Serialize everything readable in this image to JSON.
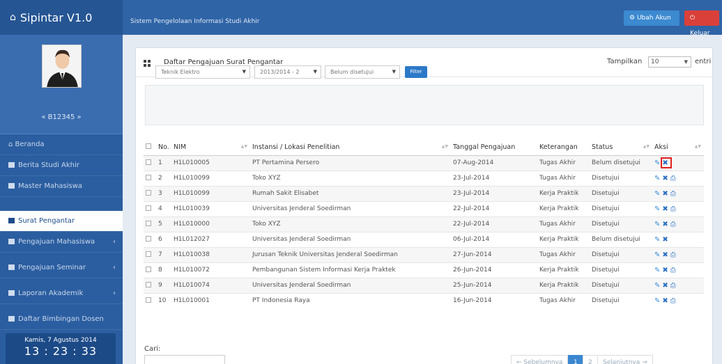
{
  "app": {
    "title": "Sipintar V1.0",
    "system_name": "Sistem Pengelolaan Informasi Studi Akhir"
  },
  "topbar": {
    "account_label": "Ubah Akun",
    "logout_label": "Keluar"
  },
  "user": {
    "id": "« B12345 »"
  },
  "sidebar": {
    "items": [
      {
        "label": "Beranda"
      },
      {
        "label": "Berita Studi Akhir"
      },
      {
        "label": "Master Mahasiswa"
      },
      {
        "label": "Surat Pengantar"
      },
      {
        "label": "Pengajuan Mahasiswa"
      },
      {
        "label": "Pengajuan Seminar"
      },
      {
        "label": "Laporan Akademik"
      },
      {
        "label": "Daftar Bimbingan Dosen"
      }
    ],
    "date": "Kamis, 7 Agustus 2014",
    "time": "13 : 23 : 33"
  },
  "panel": {
    "title": "Daftar Pengajuan Surat Pengantar",
    "show_label": "Tampilkan",
    "show_value": "10",
    "entries_label": "entri"
  },
  "filters": {
    "jurusan": "Teknik Elektro",
    "periode": "2013/2014 - 2",
    "status": "Belum disetujui",
    "button": "Filter"
  },
  "table": {
    "headers": [
      "No.",
      "NIM",
      "Instansi / Lokasi Penelitian",
      "Tanggal Pengajuan",
      "Keterangan",
      "Status",
      "Aksi"
    ],
    "rows": [
      {
        "no": "1",
        "nim": "H1L010005",
        "instansi": "PT Pertamina Persero",
        "tanggal": "07-Aug-2014",
        "ket": "Tugas Akhir",
        "status": "Belum disetujui"
      },
      {
        "no": "2",
        "nim": "H1L010099",
        "instansi": "Toko XYZ",
        "tanggal": "23-Jul-2014",
        "ket": "Tugas Akhir",
        "status": "Disetujui"
      },
      {
        "no": "3",
        "nim": "H1L010099",
        "instansi": "Rumah Sakit Elisabet",
        "tanggal": "23-Jul-2014",
        "ket": "Kerja Praktik",
        "status": "Disetujui"
      },
      {
        "no": "4",
        "nim": "H1L010039",
        "instansi": "Universitas Jenderal Soedirman",
        "tanggal": "22-Jul-2014",
        "ket": "Kerja Praktik",
        "status": "Disetujui"
      },
      {
        "no": "5",
        "nim": "H1L010000",
        "instansi": "Toko XYZ",
        "tanggal": "22-Jul-2014",
        "ket": "Tugas Akhir",
        "status": "Disetujui"
      },
      {
        "no": "6",
        "nim": "H1L012027",
        "instansi": "Universitas Jenderal Soedirman",
        "tanggal": "06-Jul-2014",
        "ket": "Kerja Praktik",
        "status": "Belum disetujui"
      },
      {
        "no": "7",
        "nim": "H1L010038",
        "instansi": "Jurusan Teknik Universitas Jenderal Soedirman",
        "tanggal": "27-Jun-2014",
        "ket": "Tugas Akhir",
        "status": "Disetujui"
      },
      {
        "no": "8",
        "nim": "H1L010072",
        "instansi": "Pembangunan Sistem Informasi Kerja Praktek",
        "tanggal": "26-Jun-2014",
        "ket": "Kerja Praktik",
        "status": "Disetujui"
      },
      {
        "no": "9",
        "nim": "H1L010074",
        "instansi": "Universitas Jenderal Soedirman",
        "tanggal": "25-Jun-2014",
        "ket": "Kerja Praktik",
        "status": "Disetujui"
      },
      {
        "no": "10",
        "nim": "H1L010001",
        "instansi": "PT Indonesia Raya",
        "tanggal": "16-Jun-2014",
        "ket": "Tugas Akhir",
        "status": "Disetujui"
      }
    ]
  },
  "search": {
    "label": "Cari:"
  },
  "pagination": {
    "prev": "← Sebelumnya",
    "pages": [
      "1",
      "2"
    ],
    "next": "Selanjutnya →"
  },
  "icons": {
    "edit": "edit-icon",
    "delete": "delete-icon",
    "print": "print-icon"
  }
}
